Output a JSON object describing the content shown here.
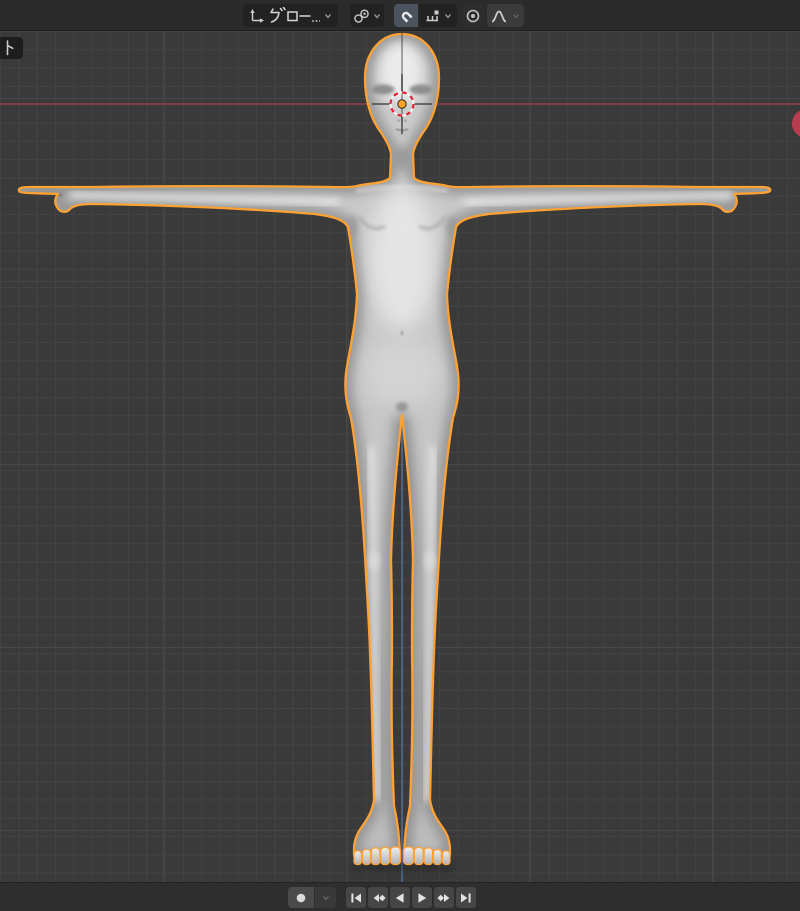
{
  "header": {
    "transform_orientation": {
      "label": "グロー...",
      "icon": "orientation-axes",
      "expanded": false
    },
    "pivot_point": {
      "icon": "pivot-point"
    },
    "snap": {
      "enabled": true,
      "toggle_icon": "magnet",
      "mode_icon": "snap-increment"
    },
    "proportional_editing": {
      "enabled": false,
      "toggle_icon": "proportional-circle",
      "falloff_icon": "smooth-falloff"
    }
  },
  "viewport": {
    "view_label": "ト",
    "model": "humanoid character in T-pose (selected)",
    "selection_outline_color": "#ffa133",
    "x_axis_color": "#7a4046",
    "z_axis_color": "#50688f",
    "grid_background": "#3a3a3b",
    "grid_line_color": "#434343",
    "cursor_3d": {
      "dash_red": "#e11e35",
      "dash_white": "#f2f2f2",
      "origin_dot": "#fca326"
    },
    "red_marker_color": "#b83d51"
  },
  "timeline": {
    "record": {
      "icon": "record-circle"
    },
    "record_options": {
      "icon": "chevron-down"
    },
    "buttons": [
      {
        "name": "jump-to-start",
        "icon": "skip-to-start"
      },
      {
        "name": "previous-keyframe",
        "icon": "prev-keyframe"
      },
      {
        "name": "play-reverse",
        "icon": "play-reverse"
      },
      {
        "name": "play-forward",
        "icon": "play-forward"
      },
      {
        "name": "next-keyframe",
        "icon": "next-keyframe"
      },
      {
        "name": "jump-to-end",
        "icon": "skip-to-end"
      }
    ]
  }
}
